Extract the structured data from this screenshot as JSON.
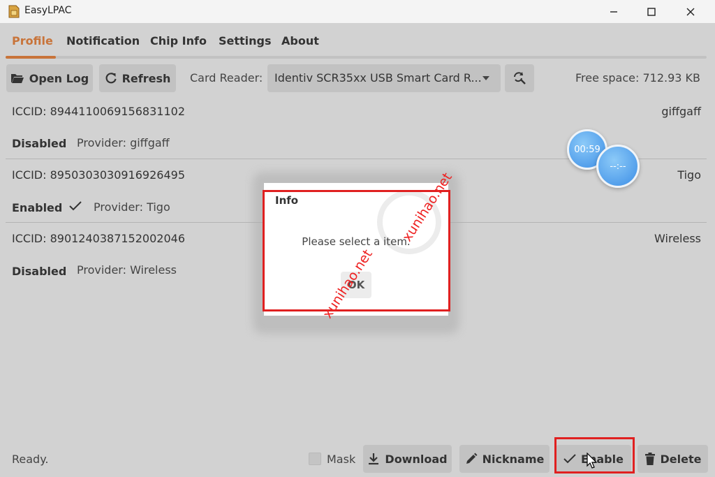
{
  "window": {
    "title": "EasyLPAC",
    "controls": [
      "minimize-icon",
      "maximize-icon",
      "close-icon"
    ]
  },
  "tabs": [
    {
      "label": "Profile",
      "active": true
    },
    {
      "label": "Notification",
      "active": false
    },
    {
      "label": "Chip Info",
      "active": false
    },
    {
      "label": "Settings",
      "active": false
    },
    {
      "label": "About",
      "active": false
    }
  ],
  "toolbar": {
    "open_log_label": "Open Log",
    "refresh_label": "Refresh",
    "card_reader_label": "Card Reader:",
    "card_reader_value": "Identiv SCR35xx USB Smart Card R...",
    "free_space": "Free space: 712.93 KB"
  },
  "profiles": [
    {
      "iccid": "ICCID: 8944110069156831102",
      "nickname": "giffgaff",
      "state": "Disabled",
      "provider": "Provider: giffgaff",
      "enabled": false
    },
    {
      "iccid": "ICCID: 8950303030916926495",
      "nickname": "Tigo",
      "state": "Enabled",
      "provider": "Provider: Tigo",
      "enabled": true
    },
    {
      "iccid": "ICCID: 8901240387152002046",
      "nickname": "Wireless",
      "state": "Disabled",
      "provider": "Provider: Wireless",
      "enabled": false
    }
  ],
  "overlay_bubbles": {
    "timer": "00:59",
    "placeholder": "--:--"
  },
  "dialog": {
    "title": "Info",
    "message": "Please select a item.",
    "ok_label": "OK"
  },
  "watermark": {
    "text": "xunihao.net"
  },
  "bottom": {
    "status": "Ready.",
    "mask_label": "Mask",
    "mask_checked": false,
    "download_label": "Download",
    "nickname_label": "Nickname",
    "enable_label": "Enable",
    "delete_label": "Delete"
  },
  "colors": {
    "accent": "#c8743a",
    "highlight": "#e02020",
    "background": "#d2d2d2"
  }
}
